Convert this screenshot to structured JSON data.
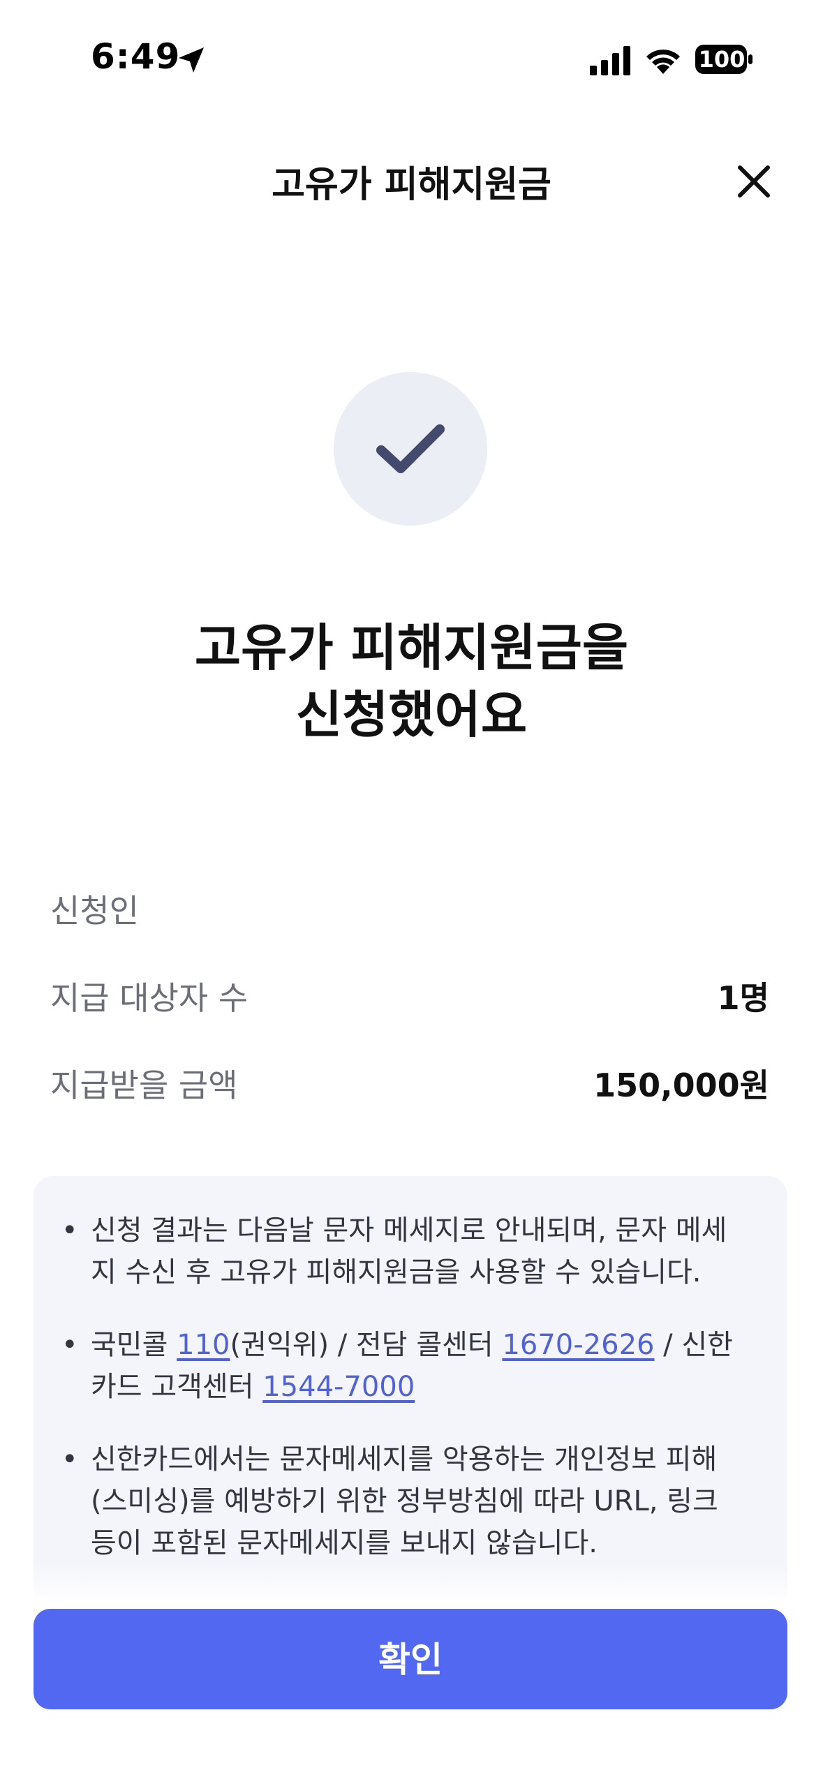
{
  "status_bar": {
    "time": "6:49",
    "battery": "100"
  },
  "header": {
    "title": "고유가 피해지원금"
  },
  "headline": {
    "line1": "고유가 피해지원금을",
    "line2": "신청했어요"
  },
  "info": {
    "applicant_label": "신청인",
    "applicant_value": "",
    "recipients_label": "지급 대상자 수",
    "recipients_value": "1명",
    "amount_label": "지급받을 금액",
    "amount_value": "150,000원"
  },
  "notices": {
    "item1": "신청 결과는 다음날 문자 메세지로 안내되며, 문자 메세지 수신 후 고유가 피해지원금을 사용할 수 있습니다.",
    "item2_prefix": "국민콜 ",
    "item2_link1": "110",
    "item2_mid1": "(권익위) / 전담 콜센터 ",
    "item2_link2": "1670-2626",
    "item2_mid2": " / 신한카드 고객센터 ",
    "item2_link3": "1544-7000",
    "item3": "신한카드에서는 문자메세지를 악용하는 개인정보 피해(스미싱)를 예방하기 위한 정부방침에 따라 URL, 링크 등이 포함된 문자메세지를 보내지 않습니다."
  },
  "footer": {
    "confirm_label": "확인"
  },
  "colors": {
    "accent": "#5368f0",
    "link": "#4f62d8",
    "check": "#434a6e",
    "check_bg": "#eceef5",
    "notice_bg": "#f4f5fa"
  }
}
